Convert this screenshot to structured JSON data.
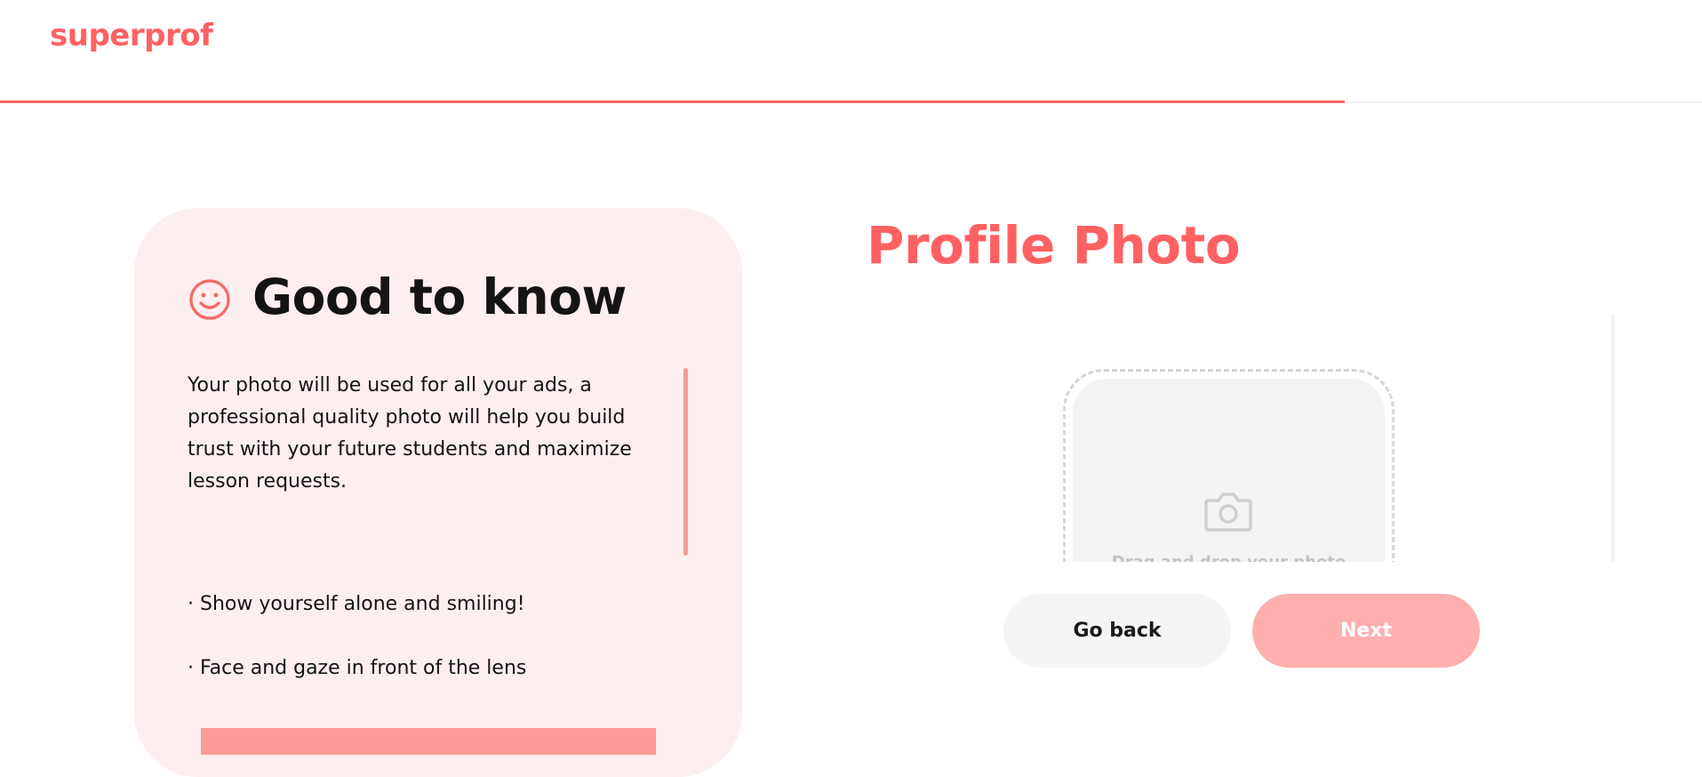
{
  "header": {
    "logo_text": "superprof",
    "progress_fraction": 0.79,
    "accent_color": "#ff6163"
  },
  "info_panel": {
    "icon": "smile-icon",
    "title": "Good to know",
    "description": "Your photo will be used for all your ads, a professional quality photo will help you build trust with your future students and maximize lesson requests.",
    "tips": [
      "· Show yourself alone and smiling!",
      "· Face and gaze in front of the lens"
    ],
    "background_color": "#fdeeef"
  },
  "main": {
    "title": "Profile Photo",
    "upload": {
      "icon": "camera-icon",
      "text": "Drag and drop your photo"
    }
  },
  "actions": {
    "back_label": "Go back",
    "next_label": "Next",
    "next_color": "#ffafae"
  }
}
